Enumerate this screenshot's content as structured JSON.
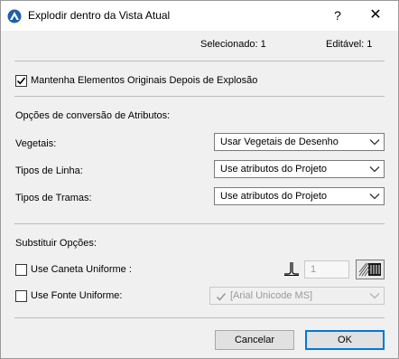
{
  "window": {
    "title": "Explodir dentro da Vista Atual",
    "help": "?",
    "close": "✕"
  },
  "status": {
    "selected": "Selecionado: 1",
    "editable": "Editável: 1"
  },
  "keep_originals": {
    "label": "Mantenha Elementos Originais Depois de Explosão",
    "checked": true
  },
  "conversion": {
    "title": "Opções de conversão de Atributos:",
    "rows": [
      {
        "label": "Vegetais:",
        "value": "Usar Vegetais de Desenho"
      },
      {
        "label": "Tipos de Linha:",
        "value": "Use atributos do Projeto"
      },
      {
        "label": "Tipos de Tramas:",
        "value": "Use atributos do Projeto"
      }
    ]
  },
  "substitute": {
    "title": "Substituir Opções:",
    "uniform_pen": {
      "label": "Use Caneta Uniforme :",
      "checked": false,
      "value": "1"
    },
    "uniform_font": {
      "label": "Use Fonte Uniforme:",
      "checked": false,
      "value": "[Arial Unicode MS]"
    }
  },
  "buttons": {
    "cancel": "Cancelar",
    "ok": "OK"
  },
  "colors": {
    "accent": "#0078d7",
    "disabled_text": "#9a9a9a",
    "dialog_bg": "#f0f0f0"
  }
}
